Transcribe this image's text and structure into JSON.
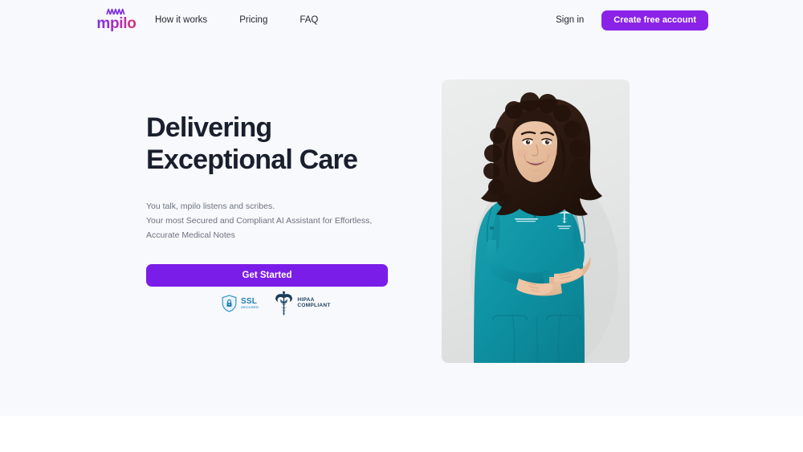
{
  "brand": {
    "logo_text": "mpilo",
    "logo_mark": "zigzag-wave-mark",
    "accent_purple": "#8a22e8",
    "cta_purple": "#7b1de8",
    "heading_color": "#1a1f2e",
    "page_bg": "#f8f9fc"
  },
  "nav": {
    "links": [
      {
        "label": "How it works"
      },
      {
        "label": "Pricing"
      },
      {
        "label": "FAQ"
      }
    ],
    "signin_label": "Sign in",
    "create_account_label": "Create free account"
  },
  "hero": {
    "title": "Delivering\nExceptional Care",
    "subtitle": "You talk, mpilo listens and scribes.\nYour most Secured and Compliant AI Assistant for Effortless, Accurate Medical Notes",
    "cta_label": "Get Started",
    "image_alt": "Smiling female healthcare professional in teal scrubs with arms crossed"
  },
  "badges": [
    {
      "icon": "ssl-shield-lock-icon",
      "title": "SSL",
      "subtitle": "SECURED",
      "color": "#1f7fb5"
    },
    {
      "icon": "caduceus-icon",
      "title": "HIPAA",
      "subtitle": "COMPLIANT",
      "color": "#1a3c5a"
    }
  ]
}
